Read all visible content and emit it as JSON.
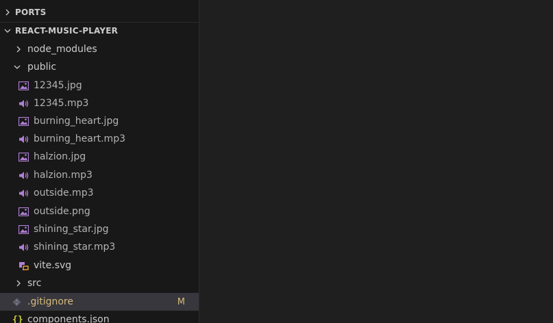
{
  "sidebar": {
    "ports_header": "PORTS",
    "project_header": "REACT-MUSIC-PLAYER",
    "items": [
      {
        "label": "node_modules",
        "kind": "folder",
        "expanded": false
      },
      {
        "label": "public",
        "kind": "folder",
        "expanded": true
      },
      {
        "label": "12345.jpg",
        "kind": "image"
      },
      {
        "label": "12345.mp3",
        "kind": "audio"
      },
      {
        "label": "burning_heart.jpg",
        "kind": "image"
      },
      {
        "label": "burning_heart.mp3",
        "kind": "audio"
      },
      {
        "label": "halzion.jpg",
        "kind": "image"
      },
      {
        "label": "halzion.mp3",
        "kind": "audio"
      },
      {
        "label": "outside.mp3",
        "kind": "audio"
      },
      {
        "label": "outside.png",
        "kind": "image"
      },
      {
        "label": "shining_star.jpg",
        "kind": "image"
      },
      {
        "label": "shining_star.mp3",
        "kind": "audio"
      },
      {
        "label": "vite.svg",
        "kind": "svg"
      },
      {
        "label": "src",
        "kind": "folder",
        "expanded": false
      },
      {
        "label": ".gitignore",
        "kind": "git",
        "badge": "M",
        "selected": true
      },
      {
        "label": "components.json",
        "kind": "json"
      }
    ]
  },
  "colors": {
    "accent_purple": "#b180d7",
    "modified": "#d7ba7d",
    "json_icon": "#cbcb41"
  },
  "icons": {
    "image": "image-file-icon",
    "audio": "audio-file-icon",
    "svg": "svg-file-icon",
    "git": "git-file-icon",
    "json": "json-file-icon",
    "collapsed": "chevron-right-icon",
    "expanded": "chevron-down-icon"
  }
}
